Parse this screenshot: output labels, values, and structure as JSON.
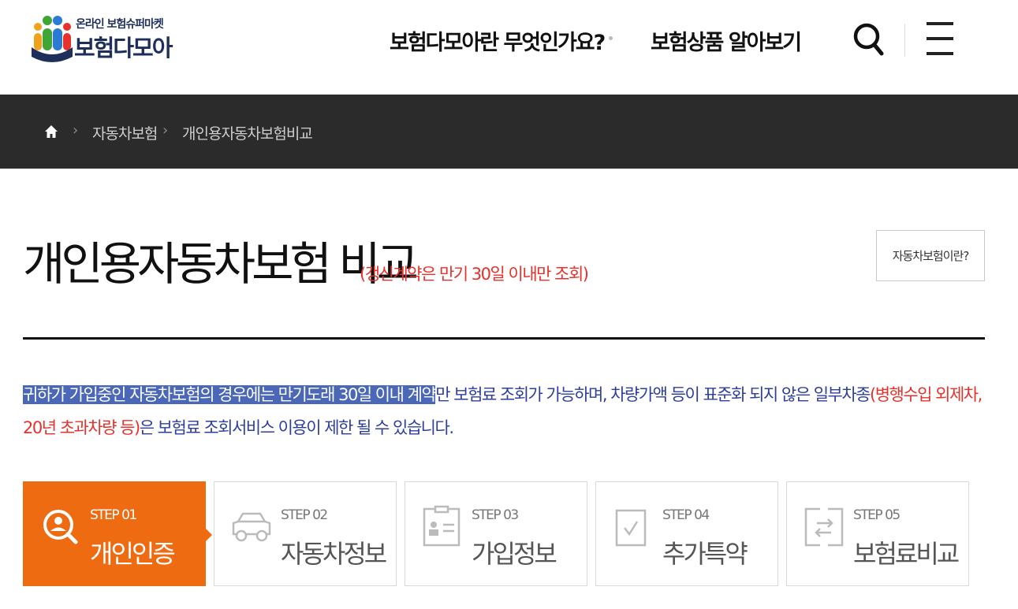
{
  "brand": {
    "subtitle": "온라인 보험슈퍼마켓",
    "name": "보험다모아"
  },
  "nav": {
    "about": "보험다모아란 무엇인가요?",
    "products": "보험상품 알아보기"
  },
  "breadcrumb": {
    "items": [
      "자동차보험",
      "개인용자동차보험비교"
    ]
  },
  "page": {
    "title": "개인용자동차보험 비교",
    "note": "(갱신계약은 만기 30일 이내만 조회)",
    "about_button": "자동차보험이란?"
  },
  "notice": {
    "highlighted": "귀하가 가입중인 자동차보험의 경우에는 만기도래 30일 이내 계약",
    "part1": "만 보험료 조회가 가능하며, 차량가액 등이 표준화 되지 않은 일부차종",
    "red": "(병행수입 외제차, 20년 초과차량 등)",
    "part2": "은 보험료 조회서비스 이용이 제한 될 수 있습니다."
  },
  "steps": [
    {
      "num": "STEP 01",
      "name": "개인인증",
      "icon": "person-search-icon",
      "active": true
    },
    {
      "num": "STEP 02",
      "name": "자동차정보",
      "icon": "car-icon",
      "active": false
    },
    {
      "num": "STEP 03",
      "name": "가입정보",
      "icon": "id-card-icon",
      "active": false
    },
    {
      "num": "STEP 04",
      "name": "추가특약",
      "icon": "checkbox-icon",
      "active": false
    },
    {
      "num": "STEP 05",
      "name": "보험료비교",
      "icon": "compare-icon",
      "active": false
    }
  ],
  "colors": {
    "accent": "#ee6b12",
    "note_red": "#e8312b",
    "notice_blue": "#2e3e9e",
    "dark_bar": "#2b2b2b"
  }
}
